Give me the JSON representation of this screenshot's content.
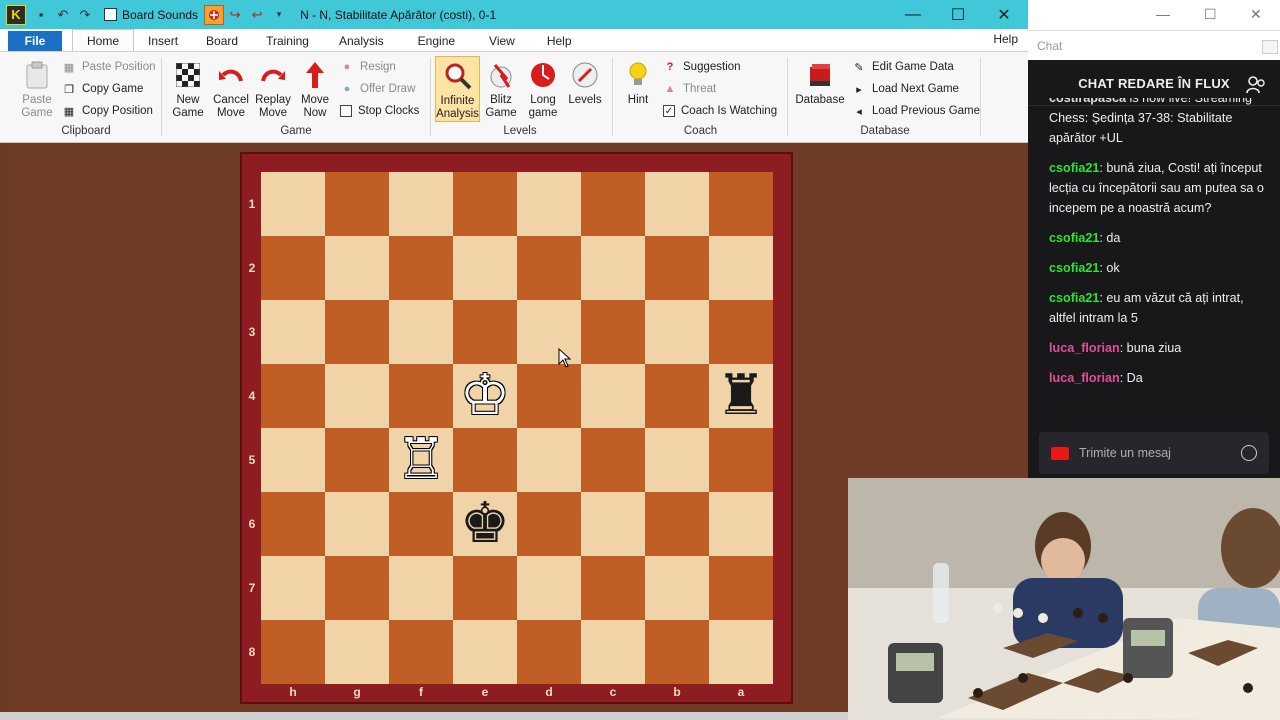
{
  "titlebar": {
    "board_sounds": "Board Sounds",
    "document_title": "N - N, Stabilitate Apărător  (costi), 0-1",
    "min": "—",
    "max": "☐",
    "close": "✕"
  },
  "menu": {
    "file": "File",
    "tabs": [
      "Home",
      "Insert",
      "Board",
      "Training",
      "Analysis",
      "Engine",
      "View",
      "Help"
    ],
    "help_right": "Help"
  },
  "ribbon": {
    "clipboard": {
      "paste_game": "Paste Game",
      "paste_position": "Paste Position",
      "copy_game": "Copy Game",
      "copy_position": "Copy Position",
      "group": "Clipboard"
    },
    "game": {
      "new_game": "New Game",
      "cancel_move": "Cancel Move",
      "replay_move": "Replay Move",
      "move_now": "Move Now",
      "resign": "Resign",
      "offer_draw": "Offer Draw",
      "stop_clocks": "Stop Clocks",
      "group": "Game"
    },
    "levels": {
      "infinite_analysis": "Infinite Analysis",
      "blitz_game": "Blitz Game",
      "long_game": "Long game",
      "levels": "Levels",
      "group": "Levels"
    },
    "coach": {
      "hint": "Hint",
      "suggestion": "Suggestion",
      "threat": "Threat",
      "coach_is_watching": "Coach Is Watching",
      "group": "Coach"
    },
    "database": {
      "database": "Database",
      "edit_game_data": "Edit Game Data",
      "load_next_game": "Load Next Game",
      "load_previous_game": "Load Previous Game",
      "group": "Database"
    }
  },
  "board": {
    "ranks": [
      "1",
      "2",
      "3",
      "4",
      "5",
      "6",
      "7",
      "8"
    ],
    "files": [
      "h",
      "g",
      "f",
      "e",
      "d",
      "c",
      "b",
      "a"
    ],
    "pieces": [
      {
        "name": "white-king",
        "glyph": "♔",
        "square": "e4"
      },
      {
        "name": "white-rook",
        "glyph": "♖",
        "square": "f5"
      },
      {
        "name": "black-king",
        "glyph": "♚",
        "square": "e6"
      },
      {
        "name": "black-rook",
        "glyph": "♜",
        "square": "a4"
      }
    ]
  },
  "chat": {
    "address": "Chat",
    "header": "CHAT REDARE ÎN FLUX",
    "messages": [
      {
        "user": "costirapasca",
        "text": " is now live! Streaming Chess: Ședința 37-38: Stabilitate apărător +UL",
        "color": "w"
      },
      {
        "user": "csofia21",
        "text": ": bună ziua, Costi! ați început lecția cu începătorii sau am putea sa o incepem pe a noastră acum?",
        "color": "g"
      },
      {
        "user": "csofia21",
        "text": ": da",
        "color": "g"
      },
      {
        "user": "csofia21",
        "text": ": ok",
        "color": "g"
      },
      {
        "user": "csofia21",
        "text": ": eu am văzut că ați intrat, altfel intram la 5",
        "color": "g"
      },
      {
        "user": "luca_florian",
        "text": ": buna ziua",
        "color": "p"
      },
      {
        "user": "luca_florian",
        "text": ": Da",
        "color": "p"
      }
    ],
    "input_placeholder": "Trimite un mesaj"
  },
  "colors": {
    "light_square": "#f0d4a8",
    "dark_square": "#c05e26",
    "titlebar": "#40c8d8",
    "file_tab": "#1b6fc4"
  }
}
